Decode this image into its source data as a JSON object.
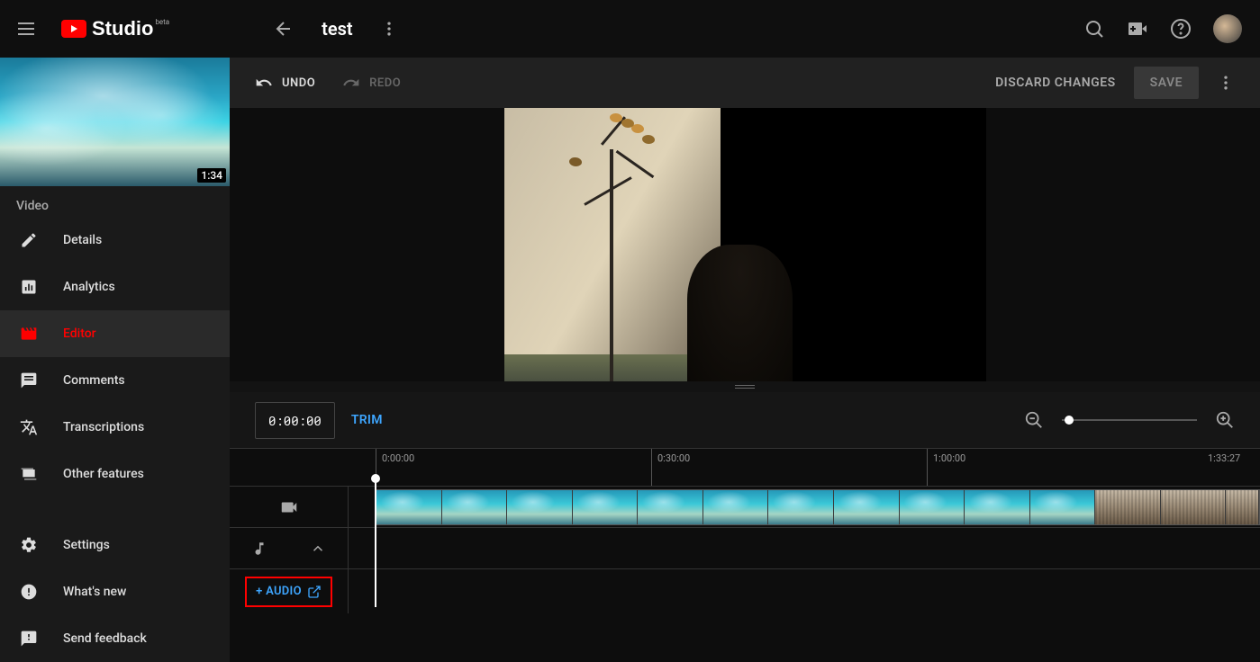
{
  "header": {
    "logo_text": "Studio",
    "logo_beta": "beta",
    "video_title": "test"
  },
  "sidebar": {
    "thumbnail_duration": "1:34",
    "section_label": "Video",
    "items": [
      {
        "label": "Details"
      },
      {
        "label": "Analytics"
      },
      {
        "label": "Editor"
      },
      {
        "label": "Comments"
      },
      {
        "label": "Transcriptions"
      },
      {
        "label": "Other features"
      }
    ],
    "footer": [
      {
        "label": "Settings"
      },
      {
        "label": "What's new"
      },
      {
        "label": "Send feedback"
      }
    ]
  },
  "toolbar": {
    "undo_label": "UNDO",
    "redo_label": "REDO",
    "discard_label": "DISCARD CHANGES",
    "save_label": "SAVE"
  },
  "timeline": {
    "current_time": "0:00:00",
    "trim_label": "TRIM",
    "ruler_marks": [
      "0:00:00",
      "0:30:00",
      "1:00:00",
      "1:33:27"
    ],
    "add_audio_label": "+ AUDIO"
  }
}
